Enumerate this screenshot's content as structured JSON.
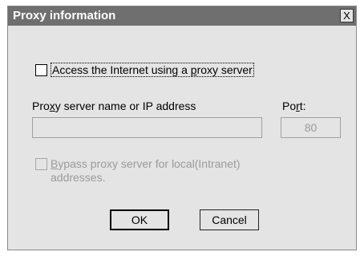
{
  "window": {
    "title": "Proxy information",
    "close_label": "X"
  },
  "proxy_checkbox": {
    "label_before": "Access the Internet using a ",
    "label_mnemonic": "p",
    "label_after": "roxy server",
    "checked": false
  },
  "server_field": {
    "label_before": "Pro",
    "label_mnemonic": "x",
    "label_after": "y server name or IP address",
    "value": ""
  },
  "port_field": {
    "label_before": "Po",
    "label_mnemonic": "r",
    "label_after": "t:",
    "value": "80"
  },
  "bypass_checkbox": {
    "label_mnemonic": "B",
    "label_line1_after": "ypass proxy server for local(Intranet)",
    "label_line2": "addresses.",
    "checked": false,
    "enabled": false
  },
  "buttons": {
    "ok_label": "OK",
    "cancel_label": "Cancel"
  }
}
